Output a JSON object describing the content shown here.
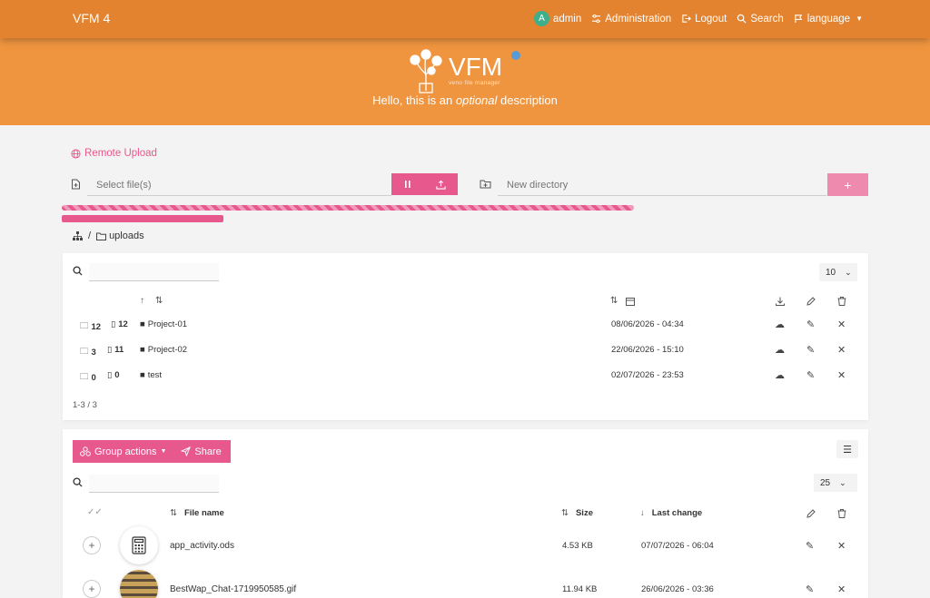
{
  "navbar": {
    "brand": "VFM 4",
    "avatar_letter": "A",
    "user": "admin",
    "administration": "Administration",
    "logout": "Logout",
    "search": "Search",
    "language": "language"
  },
  "header": {
    "logo_text": "VFM",
    "logo_sub": "veno file manager",
    "description_prefix": "Hello, this is an ",
    "description_em": "optional",
    "description_suffix": " description"
  },
  "upload": {
    "remote_upload": "Remote Upload",
    "file_placeholder": "Select file(s)",
    "dir_placeholder": "New directory"
  },
  "breadcrumb": {
    "separator": "/",
    "folder": "uploads"
  },
  "folders_table": {
    "per_page": "10",
    "rows": [
      {
        "sub_folders": "12",
        "files": "12",
        "name": "Project-01",
        "date": "08/06/2026 - 04:34"
      },
      {
        "sub_folders": "3",
        "files": "11",
        "name": "Project-02",
        "date": "22/06/2026 - 15:10"
      },
      {
        "sub_folders": "0",
        "files": "0",
        "name": "test",
        "date": "02/07/2026 - 23:53"
      }
    ],
    "counter": "1-3 / 3"
  },
  "files_table": {
    "group_actions": "Group actions",
    "share": "Share",
    "per_page": "25",
    "headers": {
      "name": "File name",
      "size": "Size",
      "last_change": "Last change"
    },
    "rows": [
      {
        "name": "app_activity.ods",
        "size": "4.53 KB",
        "date": "07/07/2026 - 06:04"
      },
      {
        "name": "BestWap_Chat-1719950585.gif",
        "size": "11.94 KB",
        "date": "26/06/2026 - 03:36"
      }
    ]
  },
  "colors": {
    "navbar": "#e4832f",
    "header": "#f0953f",
    "accent": "#e7588c"
  },
  "progress": {
    "striped_fraction": 0.71,
    "solid_fraction": 0.2
  }
}
